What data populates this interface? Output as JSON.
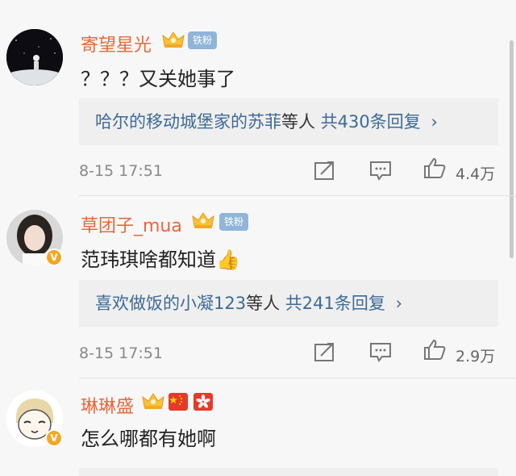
{
  "comments": [
    {
      "username": "寄望星光",
      "fan_badge": "铁粉",
      "text": "？？？又关她事了",
      "reply_summary": {
        "users": "哈尔的移动城堡家的苏菲",
        "middle": "等人",
        "total": "共430条回复",
        "chevron": "›"
      },
      "time": "8-15 17:51",
      "likes": "4.4万"
    },
    {
      "username": "草团子_mua",
      "fan_badge": "铁粉",
      "text": "范玮琪啥都知道",
      "emoji": "👍",
      "reply_summary": {
        "users": "喜欢做饭的小凝123",
        "middle": "等人",
        "total": "共241条回复",
        "chevron": "›"
      },
      "time": "8-15 17:51",
      "likes": "2.9万"
    },
    {
      "username": "琳琳盛",
      "text": "怎么哪都有她啊"
    }
  ],
  "colors": {
    "username": "#e8683a",
    "reply_link": "#3d6a97",
    "badge": "#8fb5d9",
    "verified": "#f5a623"
  },
  "icons": [
    "crown-icon",
    "repost-icon",
    "comment-icon",
    "like-icon",
    "china-flag-icon",
    "hongkong-flag-icon",
    "verified-badge-icon"
  ]
}
